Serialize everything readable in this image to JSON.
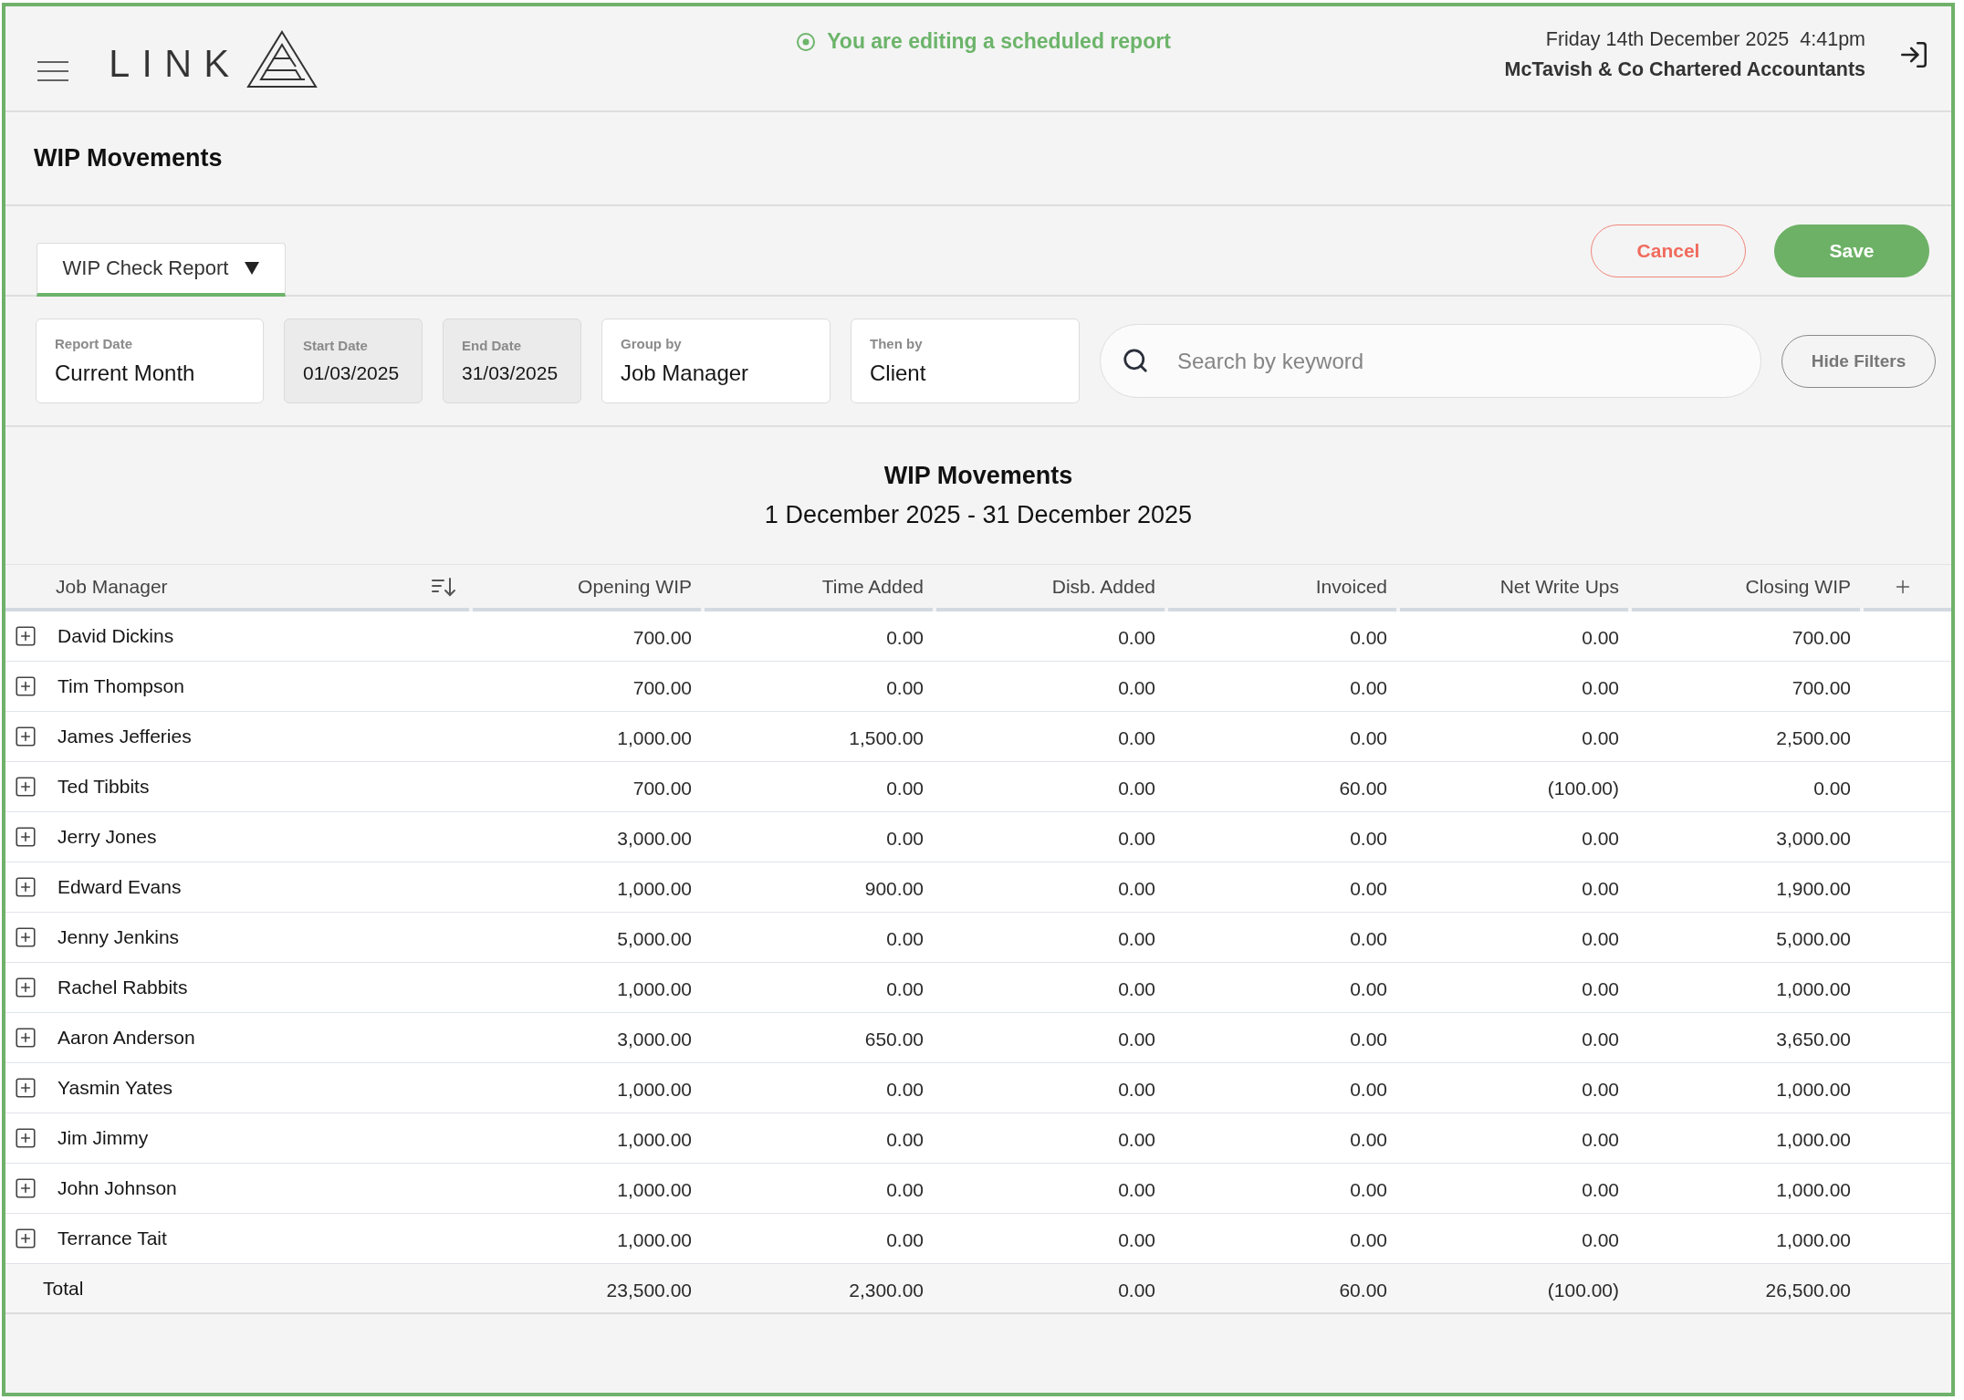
{
  "header": {
    "logo": "LINK",
    "notice": "You are editing a scheduled report",
    "date": "Friday 14th December 2025",
    "time": "4:41pm",
    "organisation": "McTavish & Co Chartered Accountants"
  },
  "page_title": "WIP Movements",
  "report_tabs": [
    {
      "label": "WIP Check Report",
      "selected": true
    }
  ],
  "actions": [
    {
      "label": "Cancel",
      "kind": "cancel"
    },
    {
      "label": "Save",
      "kind": "save"
    }
  ],
  "filters": [
    {
      "label": "Report Date",
      "value": "Current Month",
      "disabled": false
    },
    {
      "label": "Start Date",
      "value": "01/03/2025",
      "disabled": true
    },
    {
      "label": "End Date",
      "value": "31/03/2025",
      "disabled": true
    },
    {
      "label": "Group by",
      "value": "Job Manager",
      "disabled": false
    },
    {
      "label": "Then by",
      "value": "Client",
      "disabled": false
    }
  ],
  "search": {
    "placeholder": "Search by keyword"
  },
  "hide_filters_button": "Hide Filters",
  "report": {
    "title": "WIP Movements",
    "subtitle": "1 December 2025 - 31 December 2025"
  },
  "table": {
    "columns": [
      {
        "label": "Job Manager",
        "sorted": true
      },
      {
        "label": "Opening WIP",
        "sorted": false
      },
      {
        "label": "Time Added",
        "sorted": false
      },
      {
        "label": "Disb. Added",
        "sorted": false
      },
      {
        "label": "Invoiced",
        "sorted": false
      },
      {
        "label": "Net Write Ups",
        "sorted": false
      },
      {
        "label": "Closing WIP",
        "sorted": false
      }
    ],
    "rows": [
      {
        "expanded": false,
        "cells": [
          "David Dickins",
          "700.00",
          "0.00",
          "0.00",
          "0.00",
          "0.00",
          "700.00"
        ]
      },
      {
        "expanded": false,
        "cells": [
          "Tim Thompson",
          "700.00",
          "0.00",
          "0.00",
          "0.00",
          "0.00",
          "700.00"
        ]
      },
      {
        "expanded": false,
        "cells": [
          "James Jefferies",
          "1,000.00",
          "1,500.00",
          "0.00",
          "0.00",
          "0.00",
          "2,500.00"
        ]
      },
      {
        "expanded": false,
        "cells": [
          "Ted Tibbits",
          "700.00",
          "0.00",
          "0.00",
          "60.00",
          "(100.00)",
          "0.00"
        ]
      },
      {
        "expanded": false,
        "cells": [
          "Jerry Jones",
          "3,000.00",
          "0.00",
          "0.00",
          "0.00",
          "0.00",
          "3,000.00"
        ]
      },
      {
        "expanded": false,
        "cells": [
          "Edward Evans",
          "1,000.00",
          "900.00",
          "0.00",
          "0.00",
          "0.00",
          "1,900.00"
        ]
      },
      {
        "expanded": false,
        "cells": [
          "Jenny Jenkins",
          "5,000.00",
          "0.00",
          "0.00",
          "0.00",
          "0.00",
          "5,000.00"
        ]
      },
      {
        "expanded": false,
        "cells": [
          "Rachel Rabbits",
          "1,000.00",
          "0.00",
          "0.00",
          "0.00",
          "0.00",
          "1,000.00"
        ]
      },
      {
        "expanded": false,
        "cells": [
          "Aaron Anderson",
          "3,000.00",
          "650.00",
          "0.00",
          "0.00",
          "0.00",
          "3,650.00"
        ]
      },
      {
        "expanded": false,
        "cells": [
          "Yasmin Yates",
          "1,000.00",
          "0.00",
          "0.00",
          "0.00",
          "0.00",
          "1,000.00"
        ]
      },
      {
        "expanded": false,
        "cells": [
          "Jim Jimmy",
          "1,000.00",
          "0.00",
          "0.00",
          "0.00",
          "0.00",
          "1,000.00"
        ]
      },
      {
        "expanded": false,
        "cells": [
          "John Johnson",
          "1,000.00",
          "0.00",
          "0.00",
          "0.00",
          "0.00",
          "1,000.00"
        ]
      },
      {
        "expanded": false,
        "cells": [
          "Terrance Tait",
          "1,000.00",
          "0.00",
          "0.00",
          "0.00",
          "0.00",
          "1,000.00"
        ]
      }
    ],
    "total": {
      "label": "Total",
      "cells": [
        "23,500.00",
        "2,300.00",
        "0.00",
        "60.00",
        "(100.00)",
        "26,500.00"
      ]
    }
  }
}
